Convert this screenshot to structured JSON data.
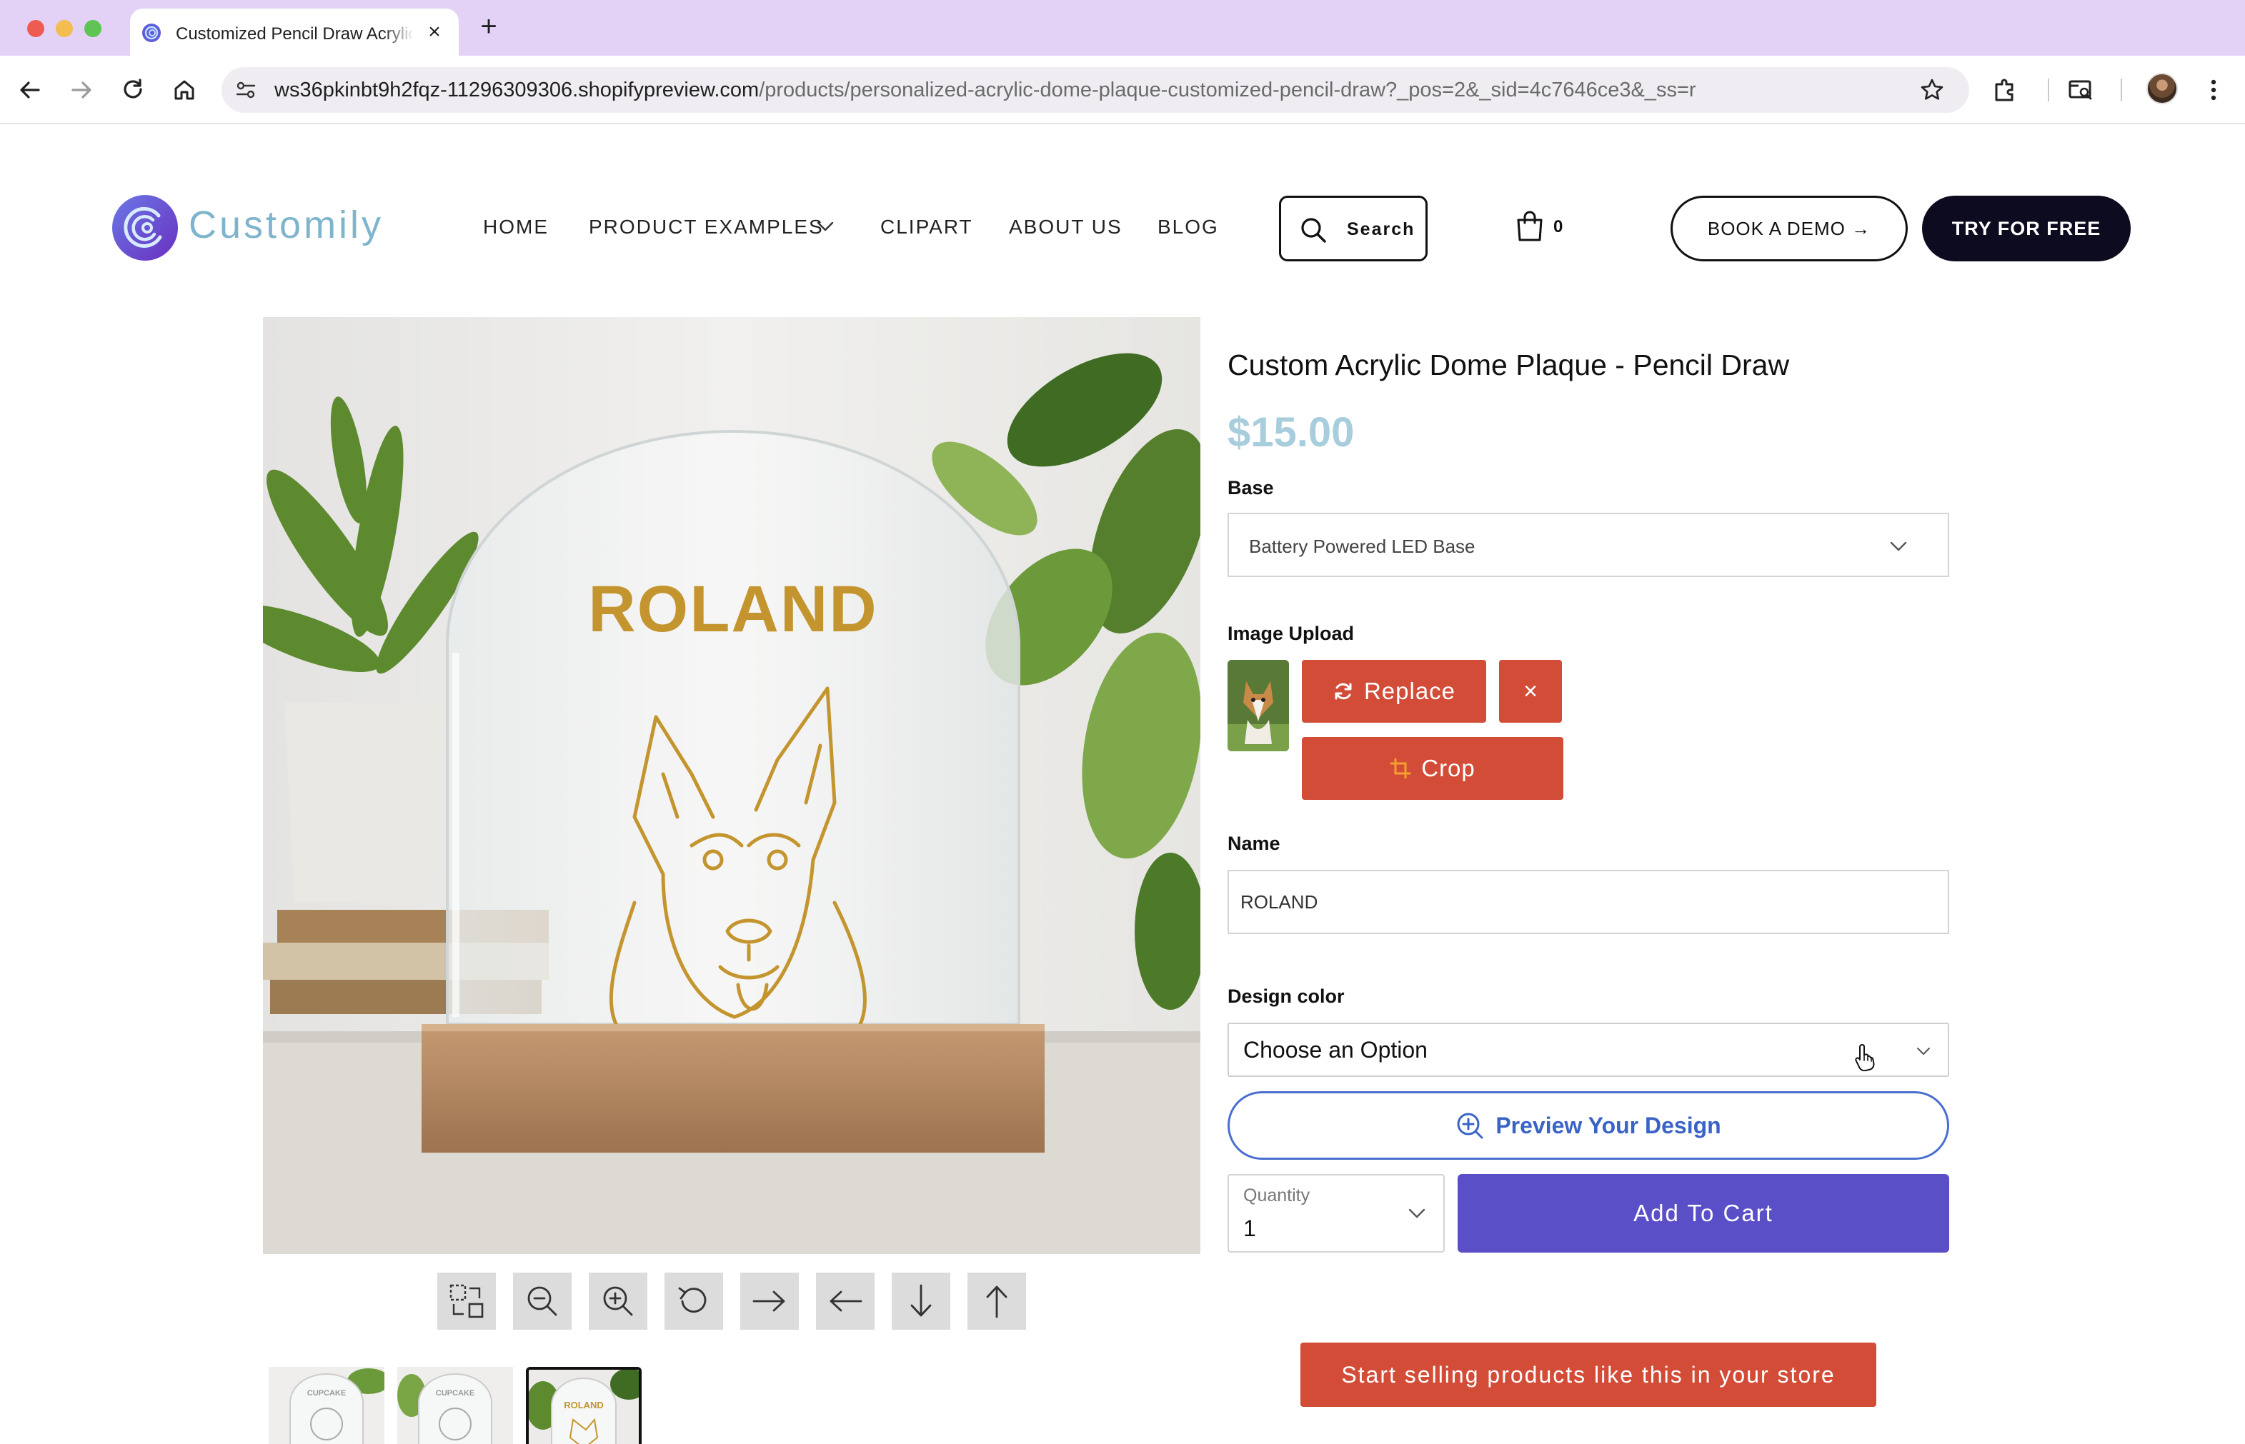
{
  "browser": {
    "tab_title": "Customized Pencil Draw Acrylic Dome Plaque",
    "tab_close": "×",
    "new_tab": "+",
    "url_host": "ws36pkinbt9h2fqz-11296309306.shopifypreview.com",
    "url_path": "/products/personalized-acrylic-dome-plaque-customized-pencil-draw?_pos=2&_sid=4c7646ce3&_ss=r"
  },
  "header": {
    "logo_text": "Customily",
    "nav": {
      "home": "HOME",
      "product_examples": "PRODUCT EXAMPLES",
      "clipart": "CLIPART",
      "about_us": "ABOUT US",
      "blog": "BLOG"
    },
    "search_label": "Search",
    "cart_count": "0",
    "book_demo": "BOOK A DEMO →",
    "try_free": "TRY FOR FREE"
  },
  "product": {
    "image_engraving_text": "ROLAND",
    "thumbnail_texts": [
      "CUPCAKE",
      "CUPCAKE",
      "ROLAND"
    ],
    "title": "Custom Acrylic Dome Plaque - Pencil Draw",
    "price": "$15.00",
    "base": {
      "label": "Base",
      "value": "Battery Powered LED Base"
    },
    "image_upload": {
      "label": "Image Upload",
      "replace_label": "Replace",
      "remove_label": "×",
      "crop_label": "Crop"
    },
    "name": {
      "label": "Name",
      "value": "ROLAND"
    },
    "design_color": {
      "label": "Design color",
      "value": "Choose an Option"
    },
    "preview_label": "Preview Your Design",
    "quantity": {
      "label": "Quantity",
      "value": "1"
    },
    "add_to_cart": "Add To Cart",
    "sell_cta": "Start selling products like this in your store"
  },
  "colors": {
    "tabbar": "#e3d2f6",
    "price": "#a8cedd",
    "red_button": "#d34c38",
    "cart_button": "#5b4fc8",
    "preview_outline": "#4a6ed0",
    "try_button": "#0d0b20",
    "logo_text": "#7fb5cc"
  },
  "icons": [
    "back-arrow-icon",
    "forward-arrow-icon",
    "reload-icon",
    "home-icon",
    "site-settings-icon",
    "star-icon",
    "extensions-icon",
    "tab-search-icon",
    "menu-dots-icon",
    "chevron-down-icon",
    "search-icon",
    "shopping-bag-icon",
    "refresh-icon",
    "close-icon",
    "crop-icon",
    "zoom-in-icon",
    "zoom-out-icon",
    "fit-icon",
    "rotate-icon",
    "arrow-right-icon",
    "arrow-left-icon",
    "arrow-down-icon",
    "arrow-up-icon",
    "hand-pointer-icon"
  ]
}
